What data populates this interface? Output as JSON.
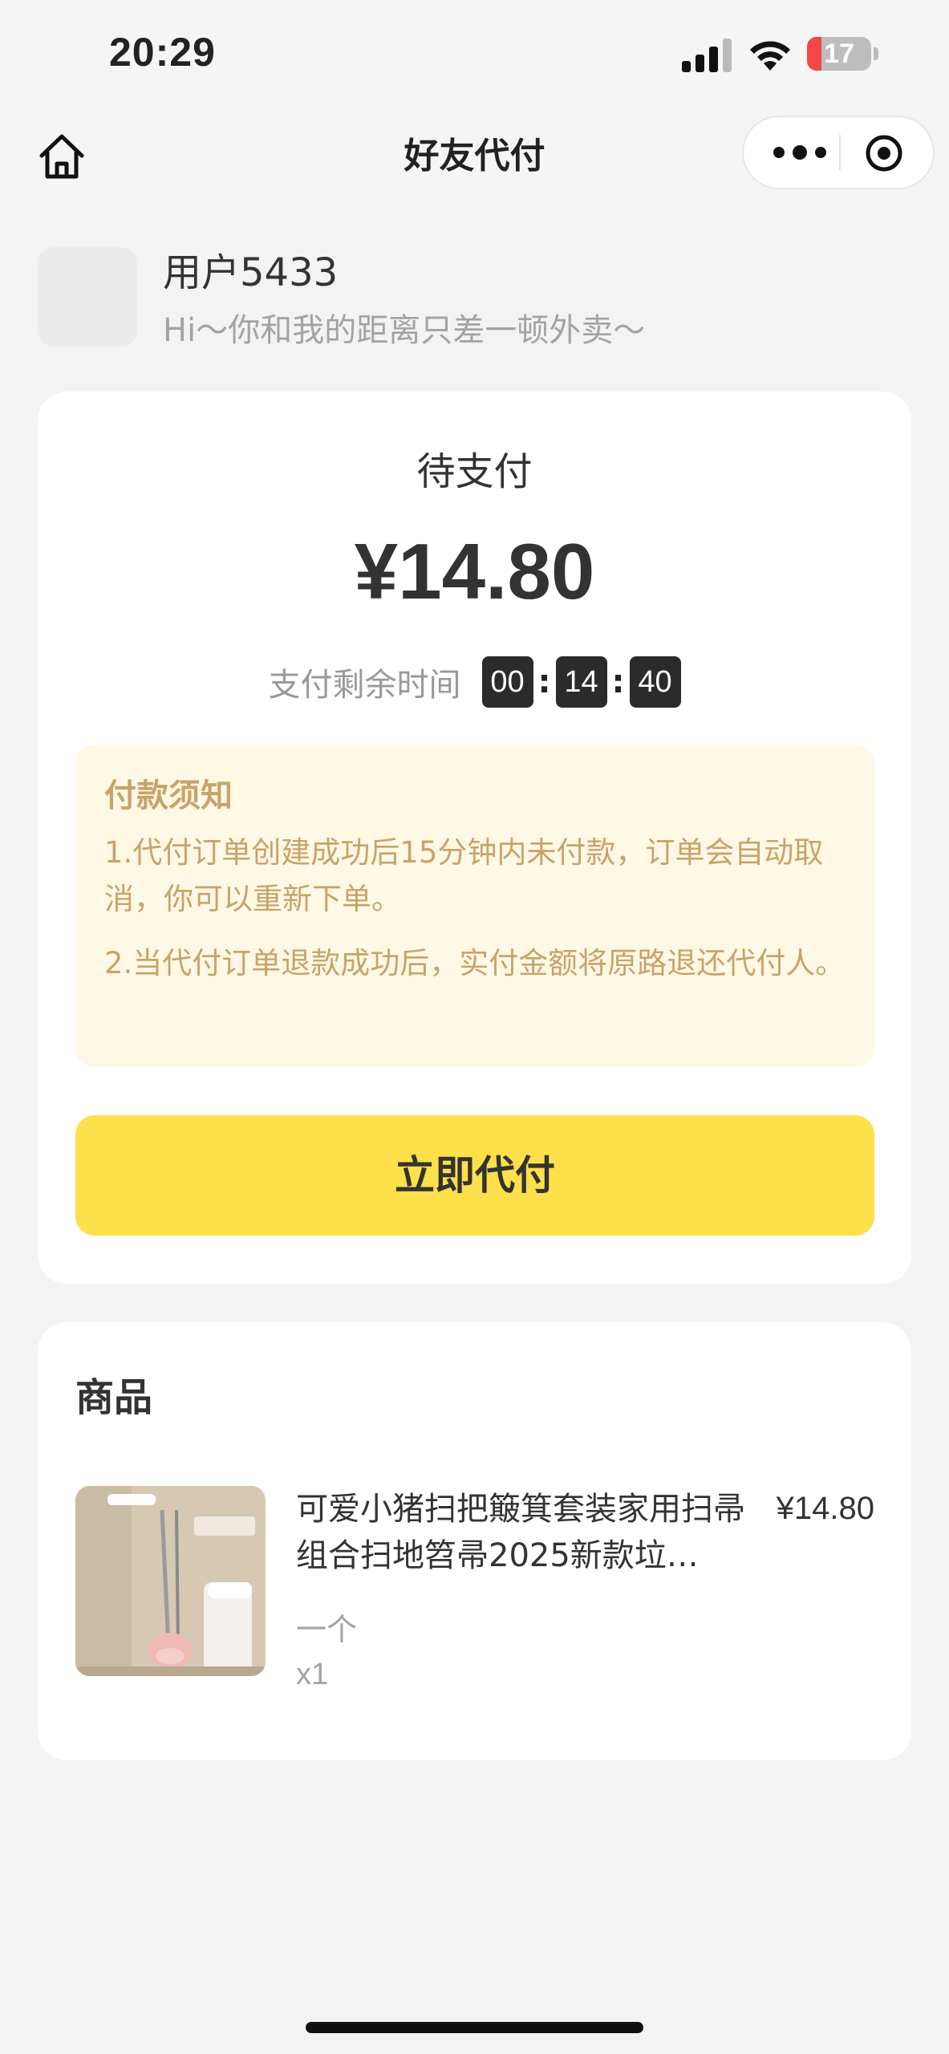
{
  "status_bar": {
    "time": "20:29",
    "battery": "17"
  },
  "nav": {
    "title": "好友代付"
  },
  "user": {
    "name": "用户5433",
    "greeting": "Hi～你和我的距离只差一顿外卖～"
  },
  "payment": {
    "status": "待支付",
    "amount": "¥14.80",
    "countdown_label": "支付剩余时间",
    "countdown": [
      "00",
      "14",
      "40"
    ],
    "notice_title": "付款须知",
    "notice_items": [
      "1.代付订单创建成功后15分钟内未付款，订单会自动取消，你可以重新下单。",
      "2.当代付订单退款成功后，实付金额将原路退还代付人。"
    ],
    "pay_button": "立即代付"
  },
  "goods": {
    "heading": "商品",
    "items": [
      {
        "name": "可爱小猪扫把簸箕套装家用扫帚组合扫地笤帚2025新款垃…",
        "price": "¥14.80",
        "spec": "一个",
        "qty": "x1"
      }
    ]
  },
  "colors": {
    "accent": "#fde04a",
    "notice_bg": "#fff8e5",
    "notice_text": "#c8a36a"
  }
}
